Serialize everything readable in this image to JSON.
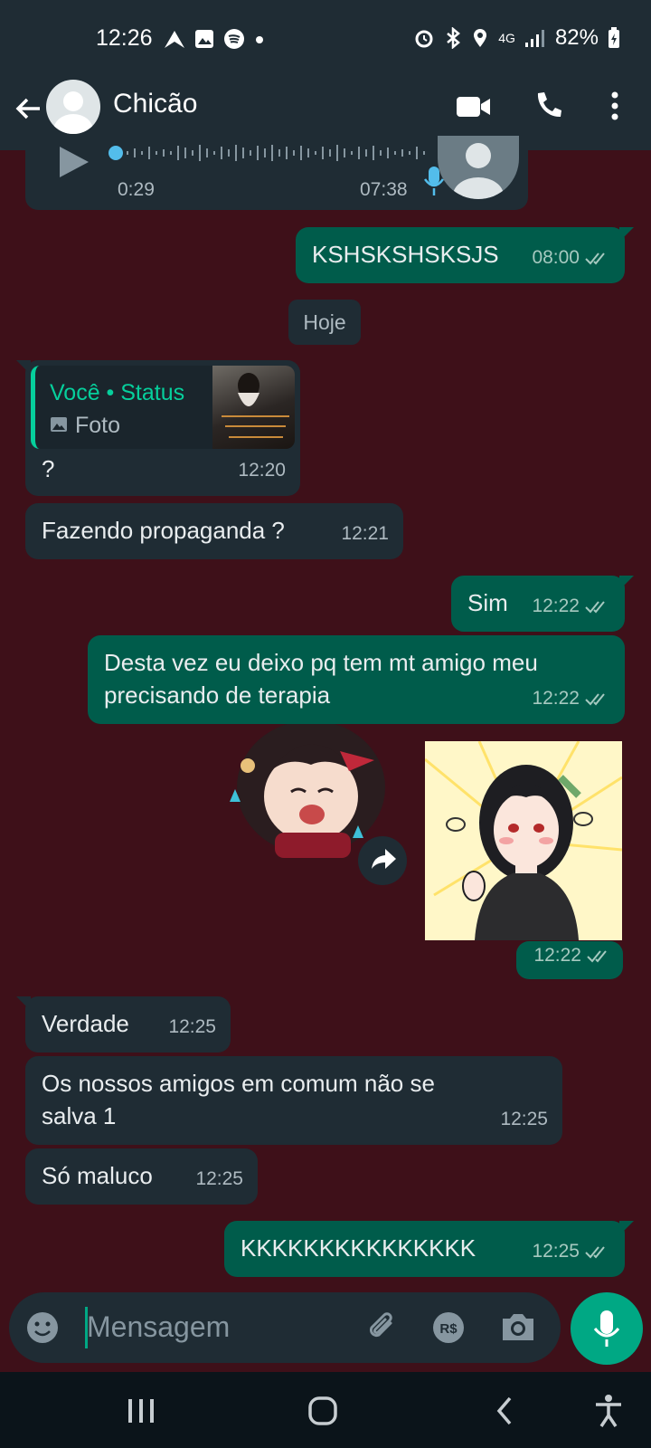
{
  "status": {
    "time": "12:26",
    "battery": "82%",
    "network": "4G"
  },
  "header": {
    "contact": "Chicão"
  },
  "voice": {
    "elapsed": "0:29",
    "time": "07:38"
  },
  "messages": [
    {
      "text": "KSHSKSHSKSJS",
      "time": "08:00"
    },
    {
      "text": "?",
      "time": "12:20"
    },
    {
      "text": "Fazendo propaganda ?",
      "time": "12:21"
    },
    {
      "text": "Sim",
      "time": "12:22"
    },
    {
      "text": "Desta vez eu deixo pq tem mt amigo meu precisando de terapia",
      "time": "12:22"
    },
    {
      "text": "",
      "time": "12:22"
    },
    {
      "text": "Verdade",
      "time": "12:25"
    },
    {
      "text": "Os nossos amigos em comum não se salva 1",
      "time": "12:25"
    },
    {
      "text": "Só maluco",
      "time": "12:25"
    },
    {
      "text": "KKKKKKKKKKKKKKK",
      "time": "12:25"
    }
  ],
  "date_chip": "Hoje",
  "reply": {
    "author": "Você • Status",
    "type": "Foto"
  },
  "input": {
    "placeholder": "Mensagem"
  },
  "colors": {
    "accent": "#00a884",
    "outgoing": "#005c4b",
    "incoming": "#1f2c34",
    "wallpaper": "#3e1019"
  }
}
